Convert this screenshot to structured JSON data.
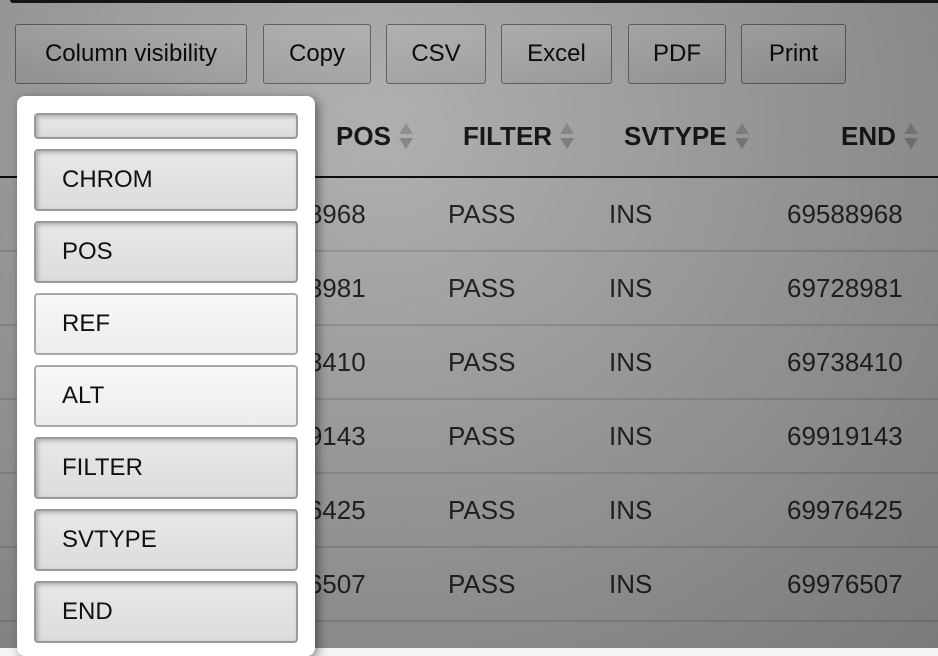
{
  "toolbar": {
    "buttons": [
      {
        "label": "Column visibility"
      },
      {
        "label": "Copy"
      },
      {
        "label": "CSV"
      },
      {
        "label": "Excel"
      },
      {
        "label": "PDF"
      },
      {
        "label": "Print"
      }
    ]
  },
  "table": {
    "columns": [
      {
        "label": "POS",
        "sort_icon": "sort-both-icon"
      },
      {
        "label": "FILTER",
        "sort_icon": "sort-both-icon"
      },
      {
        "label": "SVTYPE",
        "sort_icon": "sort-both-icon"
      },
      {
        "label": "END",
        "sort_icon": "sort-both-icon"
      }
    ],
    "rows": [
      {
        "pos": "69588968",
        "filter": "PASS",
        "svtype": "INS",
        "end": "69588968"
      },
      {
        "pos": "69728981",
        "filter": "PASS",
        "svtype": "INS",
        "end": "69728981"
      },
      {
        "pos": "69738410",
        "filter": "PASS",
        "svtype": "INS",
        "end": "69738410"
      },
      {
        "pos": "69919143",
        "filter": "PASS",
        "svtype": "INS",
        "end": "69919143"
      },
      {
        "pos": "69976425",
        "filter": "PASS",
        "svtype": "INS",
        "end": "69976425"
      },
      {
        "pos": "69976507",
        "filter": "PASS",
        "svtype": "INS",
        "end": "69976507"
      }
    ]
  },
  "column_visibility_menu": {
    "items": [
      {
        "label": "",
        "active": true
      },
      {
        "label": "CHROM",
        "active": true
      },
      {
        "label": "POS",
        "active": true
      },
      {
        "label": "REF",
        "active": false
      },
      {
        "label": "ALT",
        "active": false
      },
      {
        "label": "FILTER",
        "active": true
      },
      {
        "label": "SVTYPE",
        "active": true
      },
      {
        "label": "END",
        "active": true
      }
    ]
  }
}
